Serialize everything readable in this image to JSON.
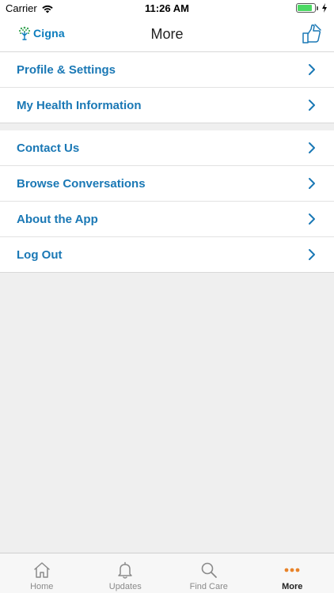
{
  "status_bar": {
    "carrier": "Carrier",
    "time": "11:26 AM",
    "battery_level": 0.85
  },
  "nav": {
    "logo_text": "Cigna",
    "title": "More"
  },
  "menu": {
    "group1": [
      {
        "label": "Profile & Settings"
      },
      {
        "label": "My Health Information"
      }
    ],
    "group2": [
      {
        "label": "Contact Us"
      },
      {
        "label": "Browse Conversations"
      },
      {
        "label": "About the App"
      },
      {
        "label": "Log Out"
      }
    ]
  },
  "tab_bar": {
    "tabs": [
      {
        "label": "Home",
        "icon": "home-icon"
      },
      {
        "label": "Updates",
        "icon": "bell-icon"
      },
      {
        "label": "Find Care",
        "icon": "search-icon"
      },
      {
        "label": "More",
        "icon": "more-dots-icon",
        "active": true
      }
    ]
  },
  "colors": {
    "accent": "#1a78b5",
    "active_tab": "#e8832a"
  }
}
